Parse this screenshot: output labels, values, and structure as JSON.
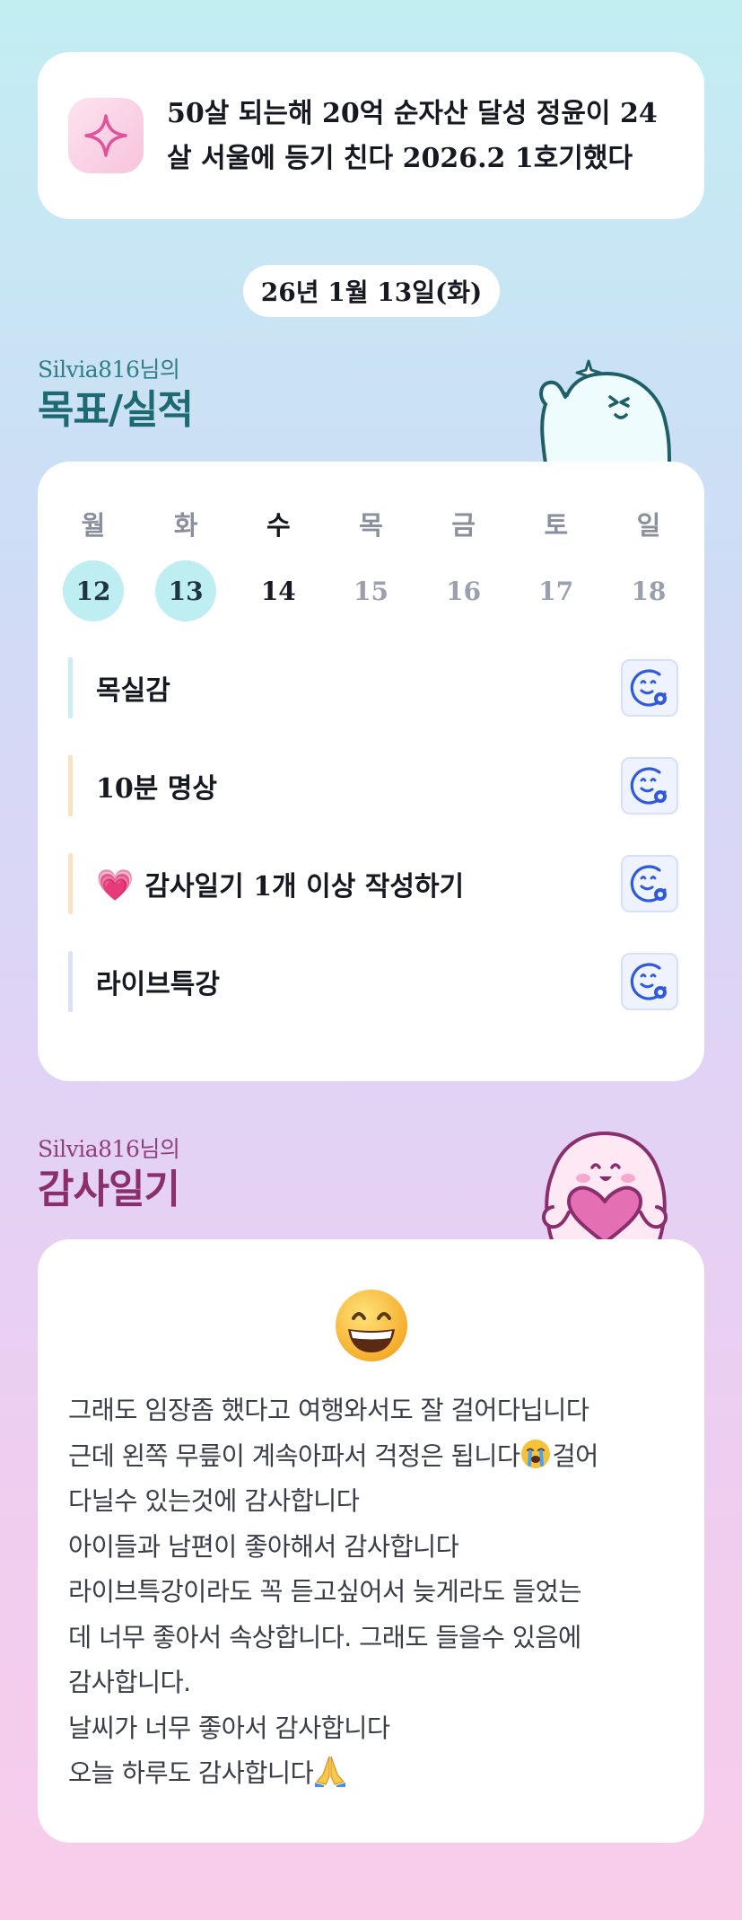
{
  "goal_banner": {
    "text": "50살 되는해 20억 순자산 달성 정윤이 24살 서울에 등기 친다 2026.2  1호기했다",
    "icon": "sparkle-icon"
  },
  "date_pill": "26년 1월 13일(화)",
  "goals_section": {
    "user_label": "Silvia816님의",
    "title": "목표/실적"
  },
  "week": {
    "weekdays": [
      "월",
      "화",
      "수",
      "목",
      "금",
      "토",
      "일"
    ],
    "dates": [
      "12",
      "13",
      "14",
      "15",
      "16",
      "17",
      "18"
    ],
    "completed": [
      "12",
      "13"
    ],
    "today": "14"
  },
  "tasks": [
    {
      "label": "목실감",
      "bar_color": "#c9eef5",
      "icon": "smiley-add-icon"
    },
    {
      "label": "10분 명상",
      "bar_color": "#fde2bf",
      "icon": "smiley-add-icon"
    },
    {
      "label": "감사일기 1개 이상 작성하기",
      "prefix": "💗",
      "bar_color": "#fde2bf",
      "icon": "smiley-add-icon"
    },
    {
      "label": "라이브특강",
      "bar_color": "#d9e2f8",
      "icon": "smiley-add-icon"
    }
  ],
  "diary_section": {
    "user_label": "Silvia816님의",
    "title": "감사일기"
  },
  "diary": {
    "mood_icon": "grinning-face-icon",
    "lines": [
      "그래도 임장좀 했다고 여행와서도 잘 걸어다닙니다",
      "근데 왼쪽 무릎이 계속아파서 걱정은 됩니다",
      "걸어",
      "다닐수 있는것에 감사합니다",
      "아이들과 남편이 좋아해서 감사합니다",
      "라이브특강이라도 꼭 듣고싶어서 늦게라도 들었는",
      "데 너무 좋아서 속상합니다. 그래도 들을수 있음에",
      "감사합니다.",
      "날씨가 너무 좋아서 감사합니다",
      "오늘 하루도 감사합니다"
    ]
  },
  "colors": {
    "goals_title": "#1e6a72",
    "diary_title": "#8a2e6d",
    "completed_circle": "#bfeef2",
    "accent_blue": "#2f5bd8"
  }
}
